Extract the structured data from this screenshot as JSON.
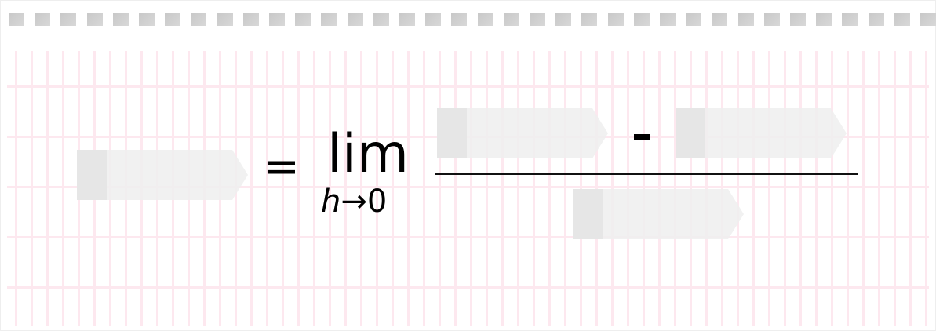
{
  "equation": {
    "equals": "=",
    "lim": "lim",
    "lim_subscript_var": "h",
    "lim_subscript_arrow": "→",
    "lim_subscript_value": "0",
    "minus": "-"
  },
  "drop_slots": [
    {
      "id": "lhs",
      "filled": false
    },
    {
      "id": "numerator-left",
      "filled": false
    },
    {
      "id": "numerator-right",
      "filled": false
    },
    {
      "id": "denominator",
      "filled": false
    }
  ],
  "colors": {
    "grid": "#fde8ef",
    "slot": "#f0f0f0",
    "binder_hole": "#cccccc"
  }
}
